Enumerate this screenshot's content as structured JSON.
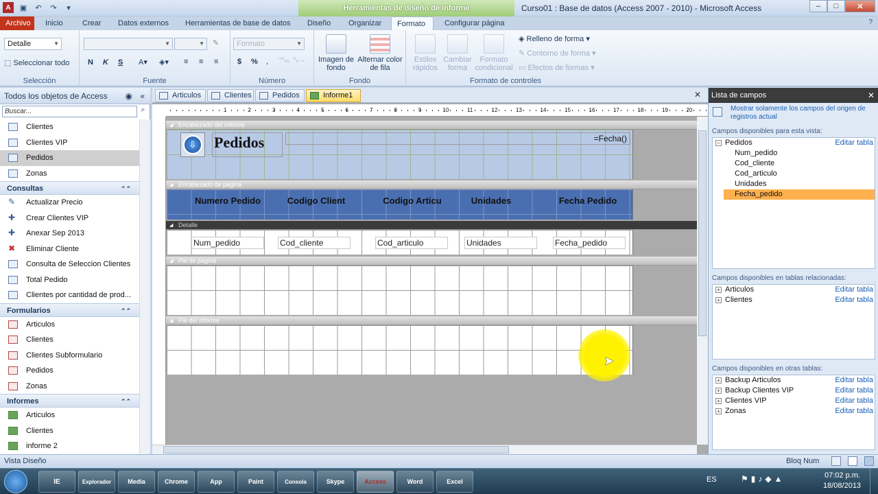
{
  "title_bar": {
    "context_tab": "Herramientas de diseño de informe",
    "window_title": "Curso01 : Base de datos (Access 2007 - 2010)  -  Microsoft Access",
    "minimize": "–",
    "maximize": "□",
    "close": "✕"
  },
  "ribbon_tabs": [
    "Archivo",
    "Inicio",
    "Crear",
    "Datos externos",
    "Herramientas de base de datos",
    "Diseño",
    "Organizar",
    "Formato",
    "Configurar página"
  ],
  "ribbon": {
    "seleccion": {
      "dropdown": "Detalle",
      "select_all": "Seleccionar todo",
      "label": "Selección"
    },
    "fuente": {
      "bold": "N",
      "italic": "K",
      "underline": "S",
      "label": "Fuente"
    },
    "numero": {
      "format": "Formato",
      "currency": "$",
      "percent": "%",
      "label": "Número"
    },
    "fondo": {
      "imagen": "Imagen de fondo",
      "alternar": "Alternar color de fila",
      "label": "Fondo"
    },
    "controles": {
      "estilos": "Estilos rápidos",
      "cambiar": "Cambiar forma",
      "condicional": "Formato condicional",
      "relleno": "Relleno de forma",
      "contorno": "Contorno de forma",
      "efectos": "Efectos de formas",
      "label": "Formato de controles"
    }
  },
  "nav": {
    "header": "Todos los objetos de Access",
    "search_placeholder": "Buscar...",
    "tables": [
      "Clientes",
      "Clientes VIP",
      "Pedidos",
      "Zonas"
    ],
    "groups": {
      "consultas": {
        "label": "Consultas",
        "items": [
          "Actualizar Precio",
          "Crear Clientes VIP",
          "Anexar  Sep 2013",
          "Eliminar Cliente",
          "Consulta de Seleccion Clientes",
          "Total Pedido",
          "Clientes por cantidad de prod..."
        ]
      },
      "formularios": {
        "label": "Formularios",
        "items": [
          "Articulos",
          "Clientes",
          "Clientes Subformulario",
          "Pedidos",
          "Zonas"
        ]
      },
      "informes": {
        "label": "Informes",
        "items": [
          "Articulos",
          "Clientes",
          "informe 2"
        ]
      }
    }
  },
  "doc_tabs": [
    "Articulos",
    "Clientes",
    "Pedidos",
    "Informe1"
  ],
  "report": {
    "sections": [
      "Encabezado del informe",
      "Encabezado de página",
      "Detalle",
      "Pie de página",
      "Pie del informe"
    ],
    "title": "Pedidos",
    "date_expr": "=Fecha()",
    "headers": [
      "Numero Pedido",
      "Codigo Client",
      "Codigo Articu",
      "Unidades",
      "Fecha Pedido"
    ],
    "fields": [
      "Num_pedido",
      "Cod_cliente",
      "Cod_articulo",
      "Unidades",
      "Fecha_pedido"
    ],
    "ruler": [
      "1",
      "2",
      "3",
      "4",
      "5",
      "6",
      "7",
      "8",
      "9",
      "10",
      "11",
      "12",
      "13",
      "14",
      "15",
      "16",
      "17",
      "18",
      "19",
      "20",
      "21"
    ]
  },
  "field_list": {
    "title": "Lista de campos",
    "show_only": "Mostrar solamente los campos del origen de registros actual",
    "available_caption": "Campos disponibles para esta vista:",
    "table": "Pedidos",
    "edit": "Editar tabla",
    "fields": [
      "Num_pedido",
      "Cod_cliente",
      "Cod_articulo",
      "Unidades",
      "Fecha_pedido"
    ],
    "related_caption": "Campos disponibles en tablas relacionadas:",
    "related": [
      "Articulos",
      "Clientes"
    ],
    "other_caption": "Campos disponibles en otras tablas:",
    "other": [
      "Backup Articulos",
      "Backup Clientes VIP",
      "Clientes VIP",
      "Zonas"
    ]
  },
  "status": {
    "left": "Vista Diseño",
    "right": "Bloq Num"
  },
  "taskbar": {
    "lang": "ES",
    "time": "07:02 p.m.",
    "date": "18/08/2013",
    "apps": [
      "IE",
      "Explorador",
      "Media",
      "Chrome",
      "App",
      "Paint",
      "Consola",
      "Skype",
      "Access",
      "Word",
      "Excel"
    ]
  }
}
